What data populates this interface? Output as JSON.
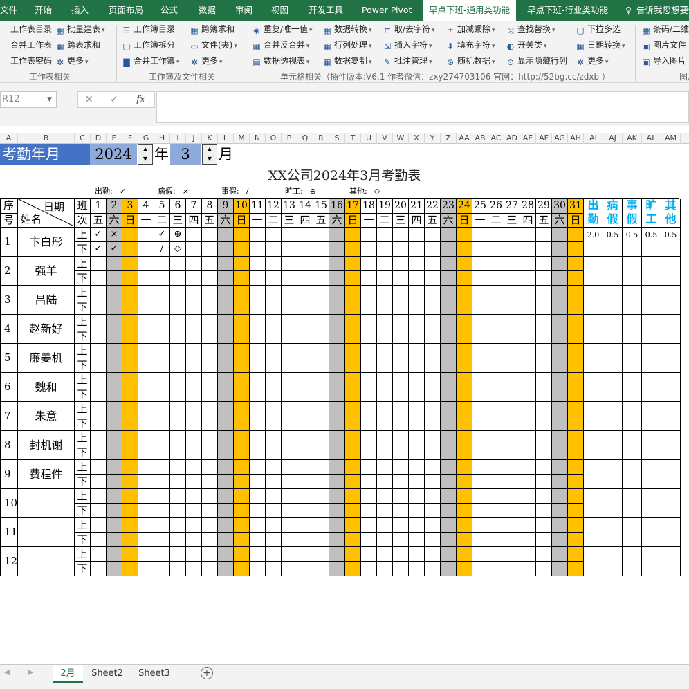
{
  "ribbon_tabs": [
    "文件",
    "开始",
    "插入",
    "页面布局",
    "公式",
    "数据",
    "审阅",
    "视图",
    "开发工具",
    "Power Pivot",
    "早点下班-通用类功能",
    "早点下班-行业类功能"
  ],
  "tell_me": "告诉我您想要做",
  "ribbon": {
    "worksheet": [
      "工作表目录",
      "合并工作表",
      "工作表密码",
      "批量建表",
      "跨表求和",
      "更多"
    ],
    "workbook": [
      "工作簿目录",
      "工作簿拆分",
      "合并工作簿",
      "跨簿求和",
      "文件(夹)",
      "更多"
    ],
    "cell1": [
      "重复/唯一值",
      "合并反合并",
      "数据透视表",
      "数据转换",
      "行列处理",
      "数据复制"
    ],
    "cell2": [
      "取/去字符",
      "插入字符",
      "批注管理",
      "加减乘除",
      "填充字符",
      "随机数据"
    ],
    "cell3": [
      "查找替换",
      "开关类",
      "显示隐藏行列",
      "下拉多选",
      "日期转换",
      "更多"
    ],
    "right": [
      "条码/二维码",
      "图片文件",
      "导入图片"
    ],
    "groups": [
      "工作表相关",
      "工作簿及文件相关",
      "单元格相关（插件版本:V6.1 作者微信：zxy274703106 官网：http://52bg.cc/zdxb ）",
      "图片"
    ]
  },
  "name_box": "R12",
  "fx_label": "fx",
  "columns": [
    "A",
    "B",
    "C",
    "D",
    "E",
    "F",
    "G",
    "H",
    "I",
    "J",
    "K",
    "L",
    "M",
    "N",
    "O",
    "P",
    "Q",
    "R",
    "S",
    "T",
    "U",
    "V",
    "W",
    "X",
    "Y",
    "Z",
    "AA",
    "AB",
    "AC",
    "AD",
    "AE",
    "AF",
    "AG",
    "AH",
    "AI",
    "AJ",
    "AK",
    "AL",
    "AM"
  ],
  "controls": {
    "label": "考勤年月",
    "year": "2024",
    "year_unit": "年",
    "month": "3",
    "month_unit": "月"
  },
  "title": "XX公司2024年3月考勤表",
  "legend": [
    {
      "label": "出勤:",
      "mark": "✓"
    },
    {
      "label": "病假:",
      "mark": "×"
    },
    {
      "label": "事假:",
      "mark": "/"
    },
    {
      "label": "旷工:",
      "mark": "⊕"
    },
    {
      "label": "其他:",
      "mark": "◇"
    }
  ],
  "header": {
    "seq1": "序",
    "seq2": "号",
    "date_label": "日期",
    "name_label": "姓名",
    "shift1": "班",
    "shift2": "次"
  },
  "days": [
    "1",
    "2",
    "3",
    "4",
    "5",
    "6",
    "7",
    "8",
    "9",
    "10",
    "11",
    "12",
    "13",
    "14",
    "15",
    "16",
    "17",
    "18",
    "19",
    "20",
    "21",
    "22",
    "23",
    "24",
    "25",
    "26",
    "27",
    "28",
    "29",
    "30",
    "31"
  ],
  "weekdays": [
    "五",
    "六",
    "日",
    "一",
    "二",
    "三",
    "四",
    "五",
    "六",
    "日",
    "一",
    "二",
    "三",
    "四",
    "五",
    "六",
    "日",
    "一",
    "二",
    "三",
    "四",
    "五",
    "六",
    "日",
    "一",
    "二",
    "三",
    "四",
    "五",
    "六",
    "日"
  ],
  "summary_headers": [
    [
      "出",
      "勤"
    ],
    [
      "病",
      "假"
    ],
    [
      "事",
      "假"
    ],
    [
      "旷",
      "工"
    ],
    [
      "其",
      "他"
    ]
  ],
  "shift_labels": [
    "上",
    "下"
  ],
  "employees": [
    {
      "seq": "1",
      "name": "卞白彤",
      "am": {
        "1": "✓",
        "2": "×",
        "5": "✓",
        "6": "⊕"
      },
      "pm": {
        "1": "✓",
        "2": "✓",
        "5": "/",
        "6": "◇"
      },
      "summary": [
        "2.0",
        "0.5",
        "0.5",
        "0.5",
        "0.5"
      ]
    },
    {
      "seq": "2",
      "name": "强羊",
      "am": {},
      "pm": {},
      "summary": []
    },
    {
      "seq": "3",
      "name": "昌陆",
      "am": {},
      "pm": {},
      "summary": []
    },
    {
      "seq": "4",
      "name": "赵新好",
      "am": {},
      "pm": {},
      "summary": []
    },
    {
      "seq": "5",
      "name": "廉姜机",
      "am": {},
      "pm": {},
      "summary": []
    },
    {
      "seq": "6",
      "name": "魏和",
      "am": {},
      "pm": {},
      "summary": []
    },
    {
      "seq": "7",
      "name": "朱意",
      "am": {},
      "pm": {},
      "summary": []
    },
    {
      "seq": "8",
      "name": "封机谢",
      "am": {},
      "pm": {},
      "summary": []
    },
    {
      "seq": "9",
      "name": "费程件",
      "am": {},
      "pm": {},
      "summary": []
    },
    {
      "seq": "10",
      "name": "",
      "am": {},
      "pm": {},
      "summary": []
    },
    {
      "seq": "11",
      "name": "",
      "am": {},
      "pm": {},
      "summary": []
    },
    {
      "seq": "12",
      "name": "",
      "am": {},
      "pm": {},
      "summary": []
    }
  ],
  "sheet_tabs": [
    "2月",
    "Sheet2",
    "Sheet3"
  ],
  "colors": {
    "excel_green": "#217346",
    "saturday_gray": "#c0c0c0",
    "sunday_gold": "#ffc000",
    "control_blue": "#4472c4",
    "control_light": "#8eaadb",
    "summary_text": "#00b0f0"
  }
}
